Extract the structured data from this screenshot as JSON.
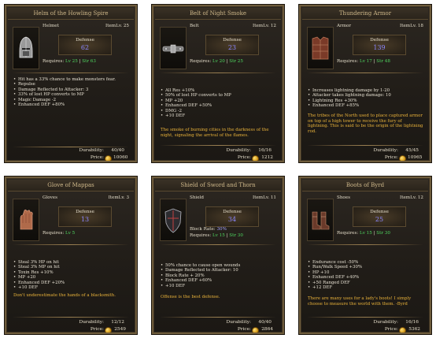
{
  "labels": {
    "item_level": "ItemLv.",
    "defense": "Defense",
    "requires": "Requires:",
    "durability": "Durability:",
    "price": "Price:"
  },
  "cards": [
    {
      "title": "Helm of the Howling Spire",
      "type": "Helmet",
      "item_level": "25",
      "stat_label": "Defense",
      "stat_value": "62",
      "requires": [
        {
          "text": "Lv 25",
          "color": "green"
        },
        {
          "text": " | ",
          "color": "plain"
        },
        {
          "text": "Str 63",
          "color": "green"
        }
      ],
      "properties": [
        "Hit has a 33% chance to make monsters fear.",
        "Repulse",
        "Damage Reflected to Attacker: 3",
        "33% of lost HP converts to MP",
        "Magic Damage -2",
        "Enhanced DEF +80%"
      ],
      "lore": "",
      "durability": "40/40",
      "price": "10060",
      "icon": "helmet-icon"
    },
    {
      "title": "Belt of Night Smoke",
      "type": "Belt",
      "item_level": "12",
      "stat_label": "Defense",
      "stat_value": "23",
      "requires": [
        {
          "text": "Lv 20",
          "color": "green"
        },
        {
          "text": " | ",
          "color": "plain"
        },
        {
          "text": "Str 25",
          "color": "green"
        }
      ],
      "properties": [
        "All Res +10%",
        "50% of lost HP converts to MP",
        "MP +20",
        "Enhanced DEF +50%",
        "DMG -2",
        "+10 DEF"
      ],
      "lore": "The smoke of burning cities in the darkness of the night, signaling the arrival of the flames.",
      "durability": "16/16",
      "price": "1212",
      "icon": "belt-icon"
    },
    {
      "title": "Thundering Armor",
      "type": "Armor",
      "item_level": "18",
      "stat_label": "Defense",
      "stat_value": "139",
      "requires": [
        {
          "text": "Lv 17",
          "color": "green"
        },
        {
          "text": " | ",
          "color": "plain"
        },
        {
          "text": "Str 48",
          "color": "green"
        }
      ],
      "properties": [
        "Increases lightning damage by 1-20",
        "Attacker takes lightning damage: 10",
        "Lightning Res +30%",
        "Enhanced DEF +85%"
      ],
      "lore": "The tribes of the North used to place captured armor on top of a high tower to receive the fury of lightning. This is said to be the origin of the lightning rod.",
      "durability": "45/45",
      "price": "10965",
      "icon": "armor-icon"
    },
    {
      "title": "Glove of Mappas",
      "type": "Gloves",
      "item_level": "3",
      "stat_label": "Defense",
      "stat_value": "13",
      "requires": [
        {
          "text": "Lv 5",
          "color": "green"
        }
      ],
      "properties": [
        "Steal 3% HP on hit",
        "Steal 3% MP on hit",
        "Toxin Res +10%",
        "MP +20",
        "Enhanced DEF +20%",
        "+10 DEF"
      ],
      "lore": "Don't underestimate the hands of a blacksmith.",
      "durability": "12/12",
      "price": "2549",
      "icon": "gloves-icon"
    },
    {
      "title": "Shield of Sword and Thorn",
      "type": "Shield",
      "item_level": "11",
      "stat_label": "Defense",
      "stat_value": "34",
      "extra_line": {
        "label": "Block Rate: ",
        "value": "30%"
      },
      "requires": [
        {
          "text": "Lv 15",
          "color": "green"
        },
        {
          "text": " | ",
          "color": "plain"
        },
        {
          "text": "Str 30",
          "color": "green"
        }
      ],
      "properties": [
        "50% chance to cause open wounds",
        "Damage Reflected to Attacker: 10",
        "Block Rate + 20%",
        "Enhanced DEF +60%",
        "+10 DEF"
      ],
      "lore": "Offense is the best defense.",
      "durability": "40/40",
      "price": "2864",
      "icon": "shield-icon"
    },
    {
      "title": "Boots of Byrd",
      "type": "Shoes",
      "item_level": "12",
      "stat_label": "Defense",
      "stat_value": "25",
      "requires": [
        {
          "text": "Lv 15",
          "color": "green"
        },
        {
          "text": " | ",
          "color": "plain"
        },
        {
          "text": "Str 30",
          "color": "green"
        }
      ],
      "properties": [
        "Endurance cost -50%",
        "Run/Walk Speed +30%",
        "HP +10",
        "Enhanced DEF +40%",
        "+50 Ranged DEF",
        "+12 DEF"
      ],
      "lore": "There are many uses for a lady's boots! I simply choose to measure the world with them. -Byrd",
      "durability": "16/16",
      "price": "5362",
      "icon": "boots-icon"
    }
  ],
  "colors": {
    "gold_text": "#e8b23a",
    "defense_value": "#8a86ff",
    "requirement_green": "#4fd860",
    "frame": "#6e5c3c"
  }
}
